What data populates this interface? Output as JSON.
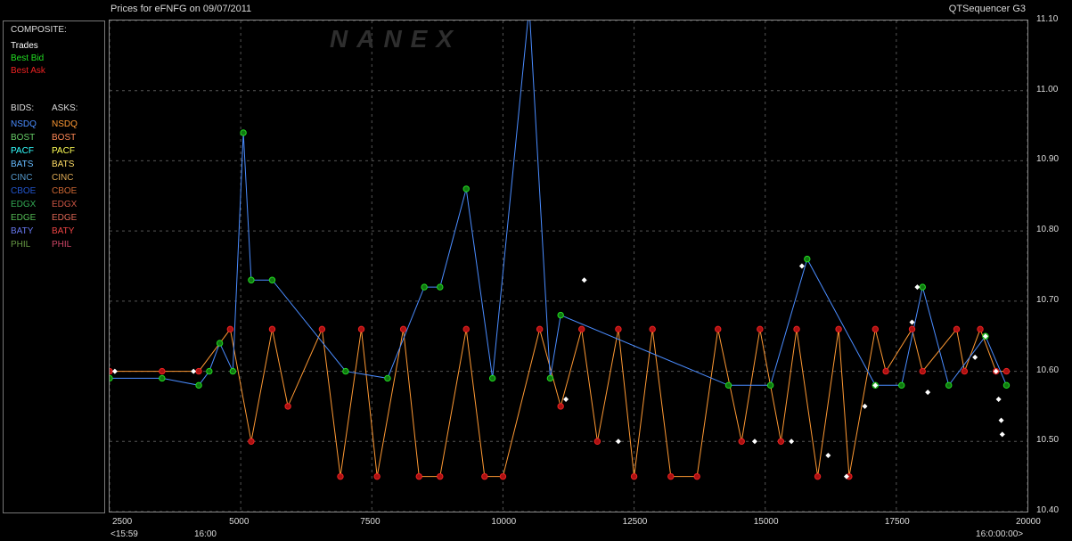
{
  "header": {
    "title_left": "Prices for  eFNFG  on  09/07/2011",
    "title_right": "QTSequencer G3",
    "watermark": "NANEX"
  },
  "legend": {
    "composite_label": "COMPOSITE:",
    "composite_items": [
      {
        "label": "Trades",
        "color": "#ffffff"
      },
      {
        "label": "Best Bid",
        "color": "#22dd22"
      },
      {
        "label": "Best Ask",
        "color": "#ee2222"
      }
    ],
    "bids_label": "BIDS:",
    "asks_label": "ASKS:",
    "exchanges": [
      {
        "bid": "NSDQ",
        "bid_color": "#4a8cff",
        "ask": "NSDQ",
        "ask_color": "#ff9933"
      },
      {
        "bid": "BOST",
        "bid_color": "#66cc66",
        "ask": "BOST",
        "ask_color": "#ff8855"
      },
      {
        "bid": "PACF",
        "bid_color": "#33ffff",
        "ask": "PACF",
        "ask_color": "#ffff55"
      },
      {
        "bid": "BATS",
        "bid_color": "#66bbff",
        "ask": "BATS",
        "ask_color": "#ffdd66"
      },
      {
        "bid": "CINC",
        "bid_color": "#5599cc",
        "ask": "CINC",
        "ask_color": "#ddaa55"
      },
      {
        "bid": "CBOE",
        "bid_color": "#2255cc",
        "ask": "CBOE",
        "ask_color": "#cc6633"
      },
      {
        "bid": "EDGX",
        "bid_color": "#33aa55",
        "ask": "EDGX",
        "ask_color": "#cc5544"
      },
      {
        "bid": "EDGE",
        "bid_color": "#55bb55",
        "ask": "EDGE",
        "ask_color": "#dd6655"
      },
      {
        "bid": "BATY",
        "bid_color": "#6677ee",
        "ask": "BATY",
        "ask_color": "#ee4444"
      },
      {
        "bid": "PHIL",
        "bid_color": "#669944",
        "ask": "PHIL",
        "ask_color": "#cc4466"
      }
    ]
  },
  "chart_data": {
    "type": "line",
    "title": "Prices for  eFNFG  on  09/07/2011",
    "xlabel": "",
    "ylabel": "",
    "xlim": [
      2500,
      20000
    ],
    "ylim": [
      10.4,
      11.1
    ],
    "x_ticks": [
      2500,
      5000,
      7500,
      10000,
      12500,
      15000,
      17500,
      20000
    ],
    "x_sub_labels": [
      {
        "x": 2500,
        "label": "<15:59"
      },
      {
        "x": 4300,
        "label": "16:00"
      },
      {
        "x": 19100,
        "label": "16:0:00:00>"
      }
    ],
    "y_ticks": [
      10.4,
      10.5,
      10.6,
      10.7,
      10.8,
      10.9,
      11.0,
      11.1
    ],
    "y_tick_labels": [
      "10.40",
      "10.50",
      "10.60",
      "10.70",
      "10.80",
      "10.90",
      "11.00",
      "11.10"
    ],
    "grid": true,
    "colors": {
      "best_bid": "#22dd22",
      "best_ask": "#ee2222",
      "trade": "#ffffff",
      "nsdq_ask": "#ff9933",
      "pacf_ask": "#ffff55",
      "nsdq_bid": "#4a8cff",
      "pacf_bid": "#33ffff"
    },
    "series": [
      {
        "name": "Best Ask",
        "values": [
          [
            2500,
            10.6
          ],
          [
            3500,
            10.6
          ],
          [
            4200,
            10.6
          ],
          [
            4800,
            10.66
          ],
          [
            5200,
            10.5
          ],
          [
            5600,
            10.66
          ],
          [
            5900,
            10.55
          ],
          [
            6550,
            10.66
          ],
          [
            6900,
            10.45
          ],
          [
            7300,
            10.66
          ],
          [
            7600,
            10.45
          ],
          [
            8100,
            10.66
          ],
          [
            8400,
            10.45
          ],
          [
            8800,
            10.45
          ],
          [
            9300,
            10.66
          ],
          [
            9650,
            10.45
          ],
          [
            10000,
            10.45
          ],
          [
            10700,
            10.66
          ],
          [
            11100,
            10.55
          ],
          [
            11500,
            10.66
          ],
          [
            11800,
            10.5
          ],
          [
            12200,
            10.66
          ],
          [
            12500,
            10.45
          ],
          [
            12850,
            10.66
          ],
          [
            13200,
            10.45
          ],
          [
            13700,
            10.45
          ],
          [
            14100,
            10.66
          ],
          [
            14550,
            10.5
          ],
          [
            14900,
            10.66
          ],
          [
            15300,
            10.5
          ],
          [
            15600,
            10.66
          ],
          [
            16000,
            10.45
          ],
          [
            16400,
            10.66
          ],
          [
            16600,
            10.45
          ],
          [
            17100,
            10.66
          ],
          [
            17300,
            10.6
          ],
          [
            17800,
            10.66
          ],
          [
            18000,
            10.6
          ],
          [
            18650,
            10.66
          ],
          [
            18800,
            10.6
          ],
          [
            19100,
            10.66
          ],
          [
            19400,
            10.6
          ],
          [
            19600,
            10.6
          ]
        ]
      },
      {
        "name": "Best Bid",
        "values": [
          [
            2500,
            10.59
          ],
          [
            3500,
            10.59
          ],
          [
            4200,
            10.58
          ],
          [
            4400,
            10.6
          ],
          [
            4600,
            10.64
          ],
          [
            4850,
            10.6
          ],
          [
            5050,
            10.94
          ],
          [
            5200,
            10.73
          ],
          [
            5600,
            10.73
          ],
          [
            7000,
            10.6
          ],
          [
            7800,
            10.59
          ],
          [
            8500,
            10.72
          ],
          [
            8800,
            10.72
          ],
          [
            9300,
            10.86
          ],
          [
            9800,
            10.59
          ],
          [
            10500,
            11.12
          ],
          [
            10900,
            10.59
          ],
          [
            11100,
            10.68
          ],
          [
            14300,
            10.58
          ],
          [
            15100,
            10.58
          ],
          [
            15800,
            10.76
          ],
          [
            17100,
            10.58
          ],
          [
            17600,
            10.58
          ],
          [
            18000,
            10.72
          ],
          [
            18500,
            10.58
          ],
          [
            19200,
            10.65
          ],
          [
            19600,
            10.58
          ]
        ]
      },
      {
        "name": "Trades",
        "values": [
          [
            2600,
            10.6
          ],
          [
            4100,
            10.6
          ],
          [
            11200,
            10.56
          ],
          [
            11550,
            10.73
          ],
          [
            12200,
            10.5
          ],
          [
            14800,
            10.5
          ],
          [
            15500,
            10.5
          ],
          [
            15700,
            10.75
          ],
          [
            16200,
            10.48
          ],
          [
            16550,
            10.45
          ],
          [
            16900,
            10.55
          ],
          [
            17100,
            10.58
          ],
          [
            17800,
            10.67
          ],
          [
            17900,
            10.72
          ],
          [
            18100,
            10.57
          ],
          [
            19000,
            10.62
          ],
          [
            19200,
            10.65
          ],
          [
            19400,
            10.6
          ],
          [
            19450,
            10.56
          ],
          [
            19500,
            10.53
          ],
          [
            19520,
            10.51
          ]
        ]
      }
    ]
  }
}
